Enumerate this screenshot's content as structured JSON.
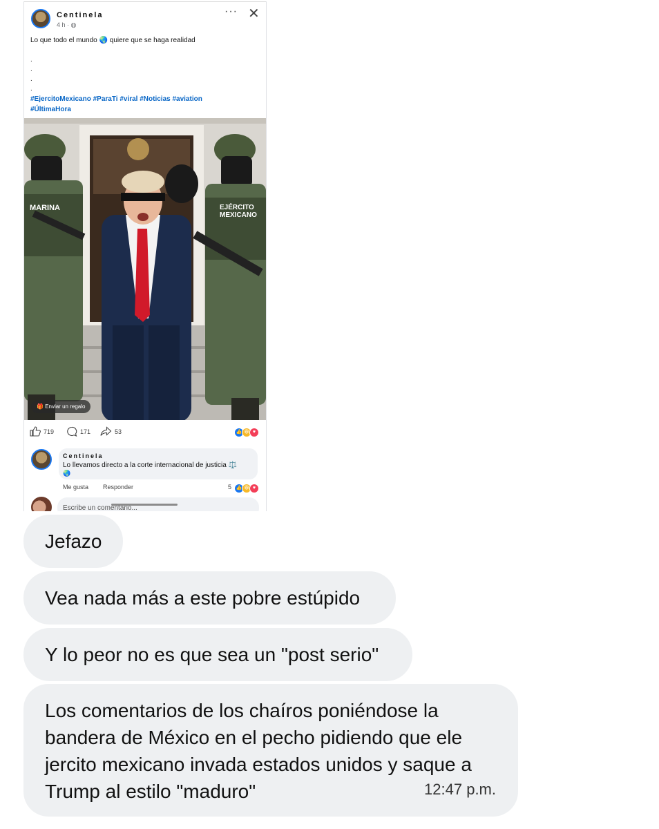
{
  "post": {
    "author": "Centinela",
    "time": "4 h · ",
    "caption": "Lo que todo el mundo 🌏 quiere que se haga realidad",
    "dots": ".\n.\n.\n.",
    "hashtags_line1": "#EjercitoMexicano #ParaTi #viral #Noticias #aviation",
    "hashtags_line2": "#ÚltimaHora",
    "photo_labels": {
      "left_patch": "MARINA",
      "right_patch_1": "EJÉRCITO",
      "right_patch_2": "MEXICANO"
    },
    "gift_button": "Enviar un regalo",
    "likes": "719",
    "comments": "171",
    "shares": "53"
  },
  "comment": {
    "author": "Centinela",
    "text": "Lo llevamos directo a la corte internacional de justicia ⚖️",
    "globe": "🌏",
    "like_label": "Me gusta",
    "reply_label": "Responder",
    "reaction_count": "5"
  },
  "write_comment_placeholder": "Escribe un comentario...",
  "messages": [
    {
      "text": "Jefazo"
    },
    {
      "text": "Vea nada más a este pobre estúpido"
    },
    {
      "text": "Y lo peor no es que sea un \"post serio\""
    },
    {
      "text": "Los comentarios de los chaíros poniéndose la bandera de México en el pecho pidiendo que ele jercito mexicano invada estados unidos y saque a Trump al estilo \"maduro\"",
      "time": "12:47 p.m."
    }
  ],
  "colors": {
    "bubble": "#eef0f2",
    "hashtag": "#0866c6",
    "fb_blue": "#1877f2",
    "tie_red": "#d11a2a"
  }
}
